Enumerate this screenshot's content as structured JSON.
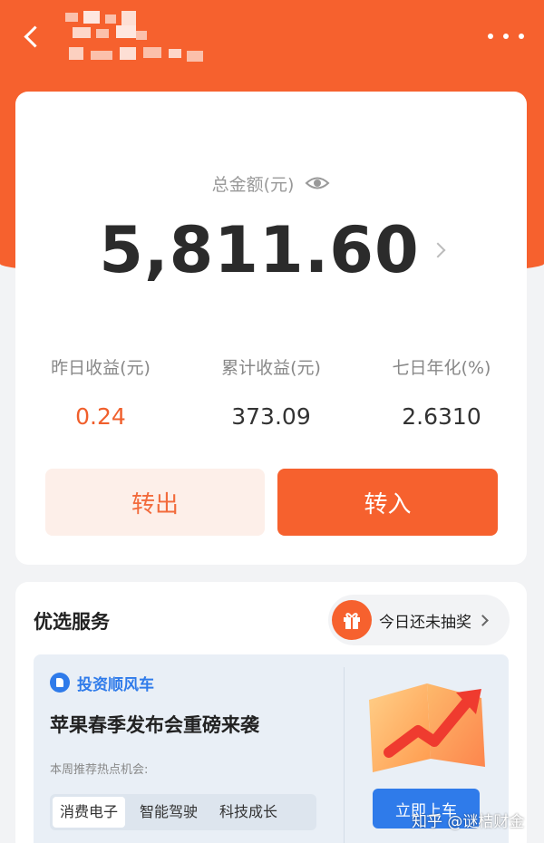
{
  "header": {
    "back_icon": "chevron-left-icon",
    "title_redacted": true,
    "more_icon": "more-horizontal-icon"
  },
  "balance": {
    "label": "总金额(元)",
    "eye_icon": "eye-icon",
    "amount": "5,811.60"
  },
  "stats": [
    {
      "label": "昨日收益(元)",
      "value": "0.24"
    },
    {
      "label": "累计收益(元)",
      "value": "373.09"
    },
    {
      "label": "七日年化(%)",
      "value": "2.6310"
    }
  ],
  "actions": {
    "transfer_out": "转出",
    "transfer_in": "转入"
  },
  "services": {
    "title": "优选服务",
    "lottery_label": "今日还未抽奖",
    "promo": {
      "brand": "投资顺风车",
      "headline": "苹果春季发布会重磅来袭",
      "subtitle": "本周推荐热点机会:",
      "tags": [
        "消费电子",
        "智能驾驶",
        "科技成长"
      ],
      "cta": "立即上车"
    }
  },
  "watermark": "知乎 @谜桔财金",
  "colors": {
    "brand_orange": "#f6612e",
    "accent_blue": "#2f7bea",
    "page_bg": "#f2f3f5"
  }
}
